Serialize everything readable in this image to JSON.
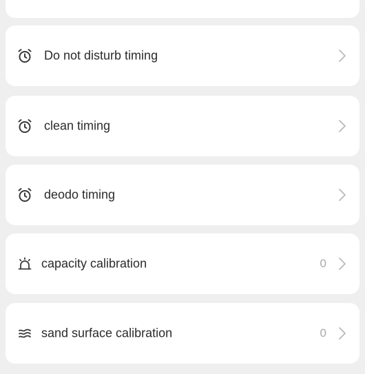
{
  "settings_list": {
    "items": [
      {
        "label": "Do not disturb timing",
        "icon": "alarm-clock-icon",
        "value": ""
      },
      {
        "label": "clean timing",
        "icon": "alarm-clock-icon",
        "value": ""
      },
      {
        "label": "deodo timing",
        "icon": "alarm-clock-icon",
        "value": ""
      },
      {
        "label": "capacity calibration",
        "icon": "tray-bell-icon",
        "value": "0"
      },
      {
        "label": "sand surface calibration",
        "icon": "wave-lines-icon",
        "value": "0"
      }
    ]
  },
  "colors": {
    "background": "#efefef",
    "card": "#ffffff",
    "text": "#2b2b2b",
    "secondary": "#a9a9a9"
  }
}
